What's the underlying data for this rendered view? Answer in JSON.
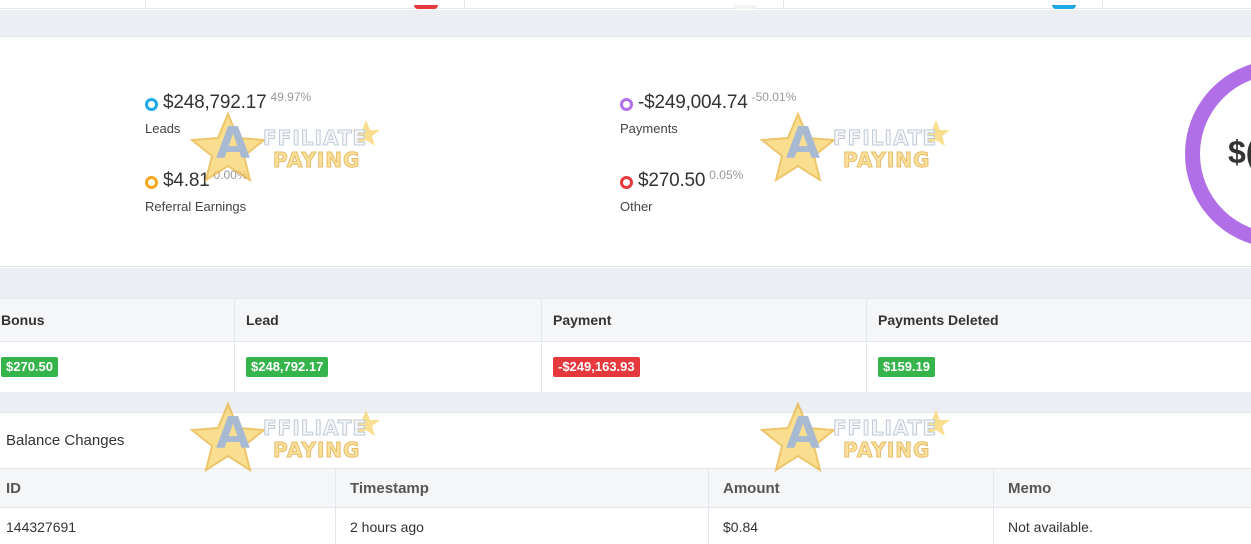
{
  "colors": {
    "blue": "#1ea8e6",
    "orange": "#f5a623",
    "purple": "#b06fe6",
    "red": "#e6393e",
    "green": "#36b44c"
  },
  "summary": {
    "left": [
      {
        "value": "$248,792.17",
        "pct": "49.97%",
        "label": "Leads",
        "color": "#1ea8e6"
      },
      {
        "value": "$4.81",
        "pct": "0.00%",
        "label": "Referral Earnings",
        "color": "#f5a623"
      }
    ],
    "right": [
      {
        "value": "-$249,004.74",
        "pct": "-50.01%",
        "label": "Payments",
        "color": "#b06fe6"
      },
      {
        "value": "$270.50",
        "pct": "0.05%",
        "label": "Other",
        "color": "#e6393e"
      }
    ],
    "donut_text": "$("
  },
  "breakdown": {
    "headers": [
      "Bonus",
      "Lead",
      "Payment",
      "Payments Deleted"
    ],
    "values": [
      {
        "text": "$270.50",
        "status": "positive"
      },
      {
        "text": "$248,792.17",
        "status": "positive"
      },
      {
        "text": "-$249,163.93",
        "status": "negative"
      },
      {
        "text": "$159.19",
        "status": "positive"
      }
    ]
  },
  "balance_changes": {
    "title": "Balance Changes",
    "headers": [
      "ID",
      "Timestamp",
      "Amount",
      "Memo"
    ],
    "rows": [
      [
        "144327691",
        "2 hours ago",
        "$0.84",
        "Not available."
      ]
    ]
  },
  "watermark": {
    "letter": "A",
    "line1": "FFILIATE",
    "line2": "PAYING"
  }
}
